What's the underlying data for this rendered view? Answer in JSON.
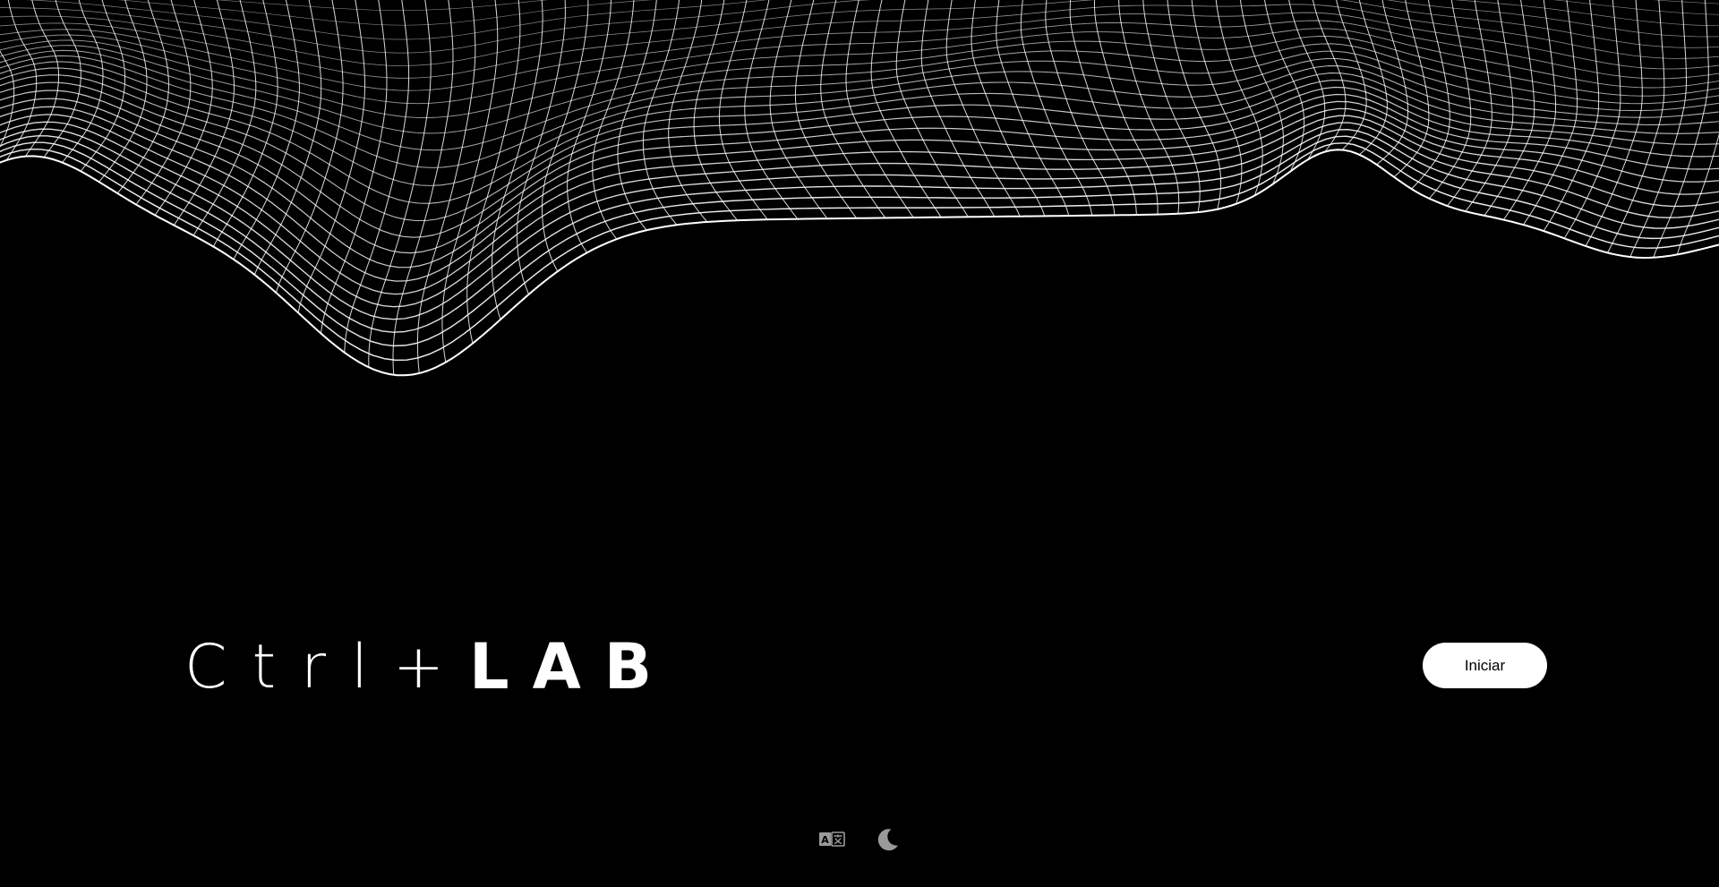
{
  "brand": {
    "prefix": "Ctrl+",
    "suffix": "LAB"
  },
  "actions": {
    "start_label": "Iniciar"
  },
  "controls": {
    "language_icon": "translate-icon",
    "theme_icon": "moon-icon"
  },
  "colors": {
    "background": "#000000",
    "foreground": "#ffffff",
    "button_text": "#000000",
    "icon_muted": "#9a9a9a"
  }
}
